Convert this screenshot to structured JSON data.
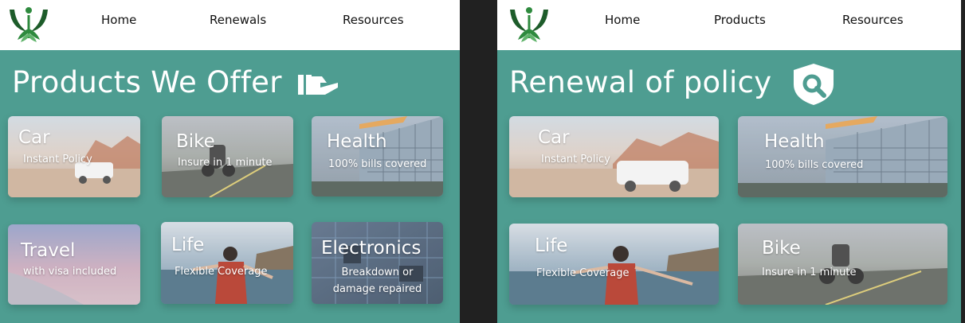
{
  "left_page": {
    "nav": [
      "Home",
      "Renewals",
      "Resources"
    ],
    "title": "Products We Offer",
    "title_icon": "hand-offer-icon",
    "cards": [
      {
        "title": "Car",
        "subtitle": "Instant Policy",
        "image": "car-desert"
      },
      {
        "title": "Bike",
        "subtitle": "Insure in 1 minute",
        "image": "motorbike-road"
      },
      {
        "title": "Health",
        "subtitle": "100% bills covered",
        "image": "hospital-building"
      },
      {
        "title": "Travel",
        "subtitle": "with visa included",
        "image": "airplane-wing"
      },
      {
        "title": "Life",
        "subtitle": "Flexible Coverage",
        "image": "woman-by-sea"
      },
      {
        "title": "Electronics",
        "subtitle": "Breakdown or damage repaired",
        "image": "circuit-board"
      }
    ]
  },
  "right_page": {
    "nav": [
      "Home",
      "Products",
      "Resources"
    ],
    "title": "Renewal of policy",
    "title_icon": "shield-search-icon",
    "cards": [
      {
        "title": "Car",
        "subtitle": "Instant Policy",
        "image": "car-desert"
      },
      {
        "title": "Health",
        "subtitle": "100% bills covered",
        "image": "hospital-building"
      },
      {
        "title": "Life",
        "subtitle": "Flexible Coverage",
        "image": "woman-by-sea"
      },
      {
        "title": "Bike",
        "subtitle": "Insure in 1 minute",
        "image": "motorbike-road"
      }
    ]
  },
  "colors": {
    "background": "#4e9d91",
    "navbar": "#ffffff",
    "divider": "#212121",
    "logo_green": "#2e8a3e",
    "logo_dark": "#1d5c2a",
    "text_light": "#ffffff"
  }
}
